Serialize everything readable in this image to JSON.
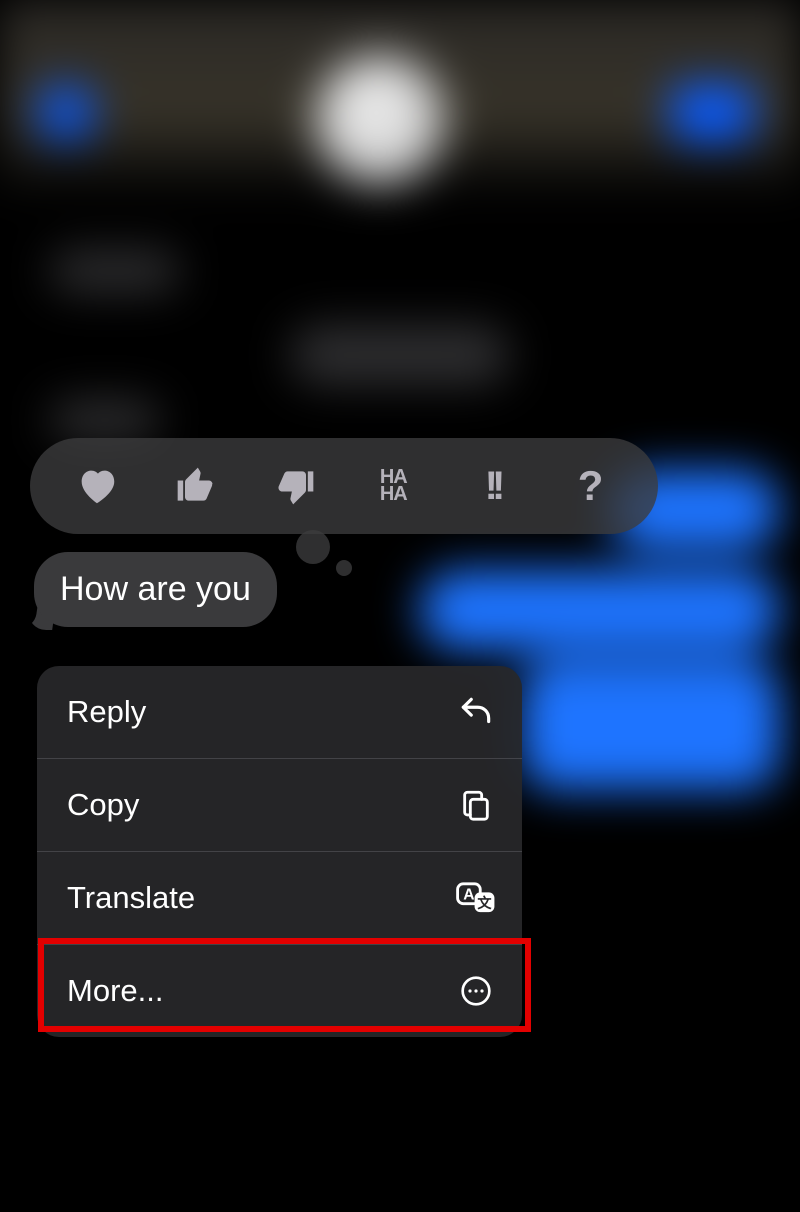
{
  "message": {
    "text": "How are you"
  },
  "tapback_reactions": [
    "heart",
    "thumbs-up",
    "thumbs-down",
    "haha",
    "exclaim",
    "question"
  ],
  "context_menu": {
    "reply": "Reply",
    "copy": "Copy",
    "translate": "Translate",
    "more": "More..."
  }
}
